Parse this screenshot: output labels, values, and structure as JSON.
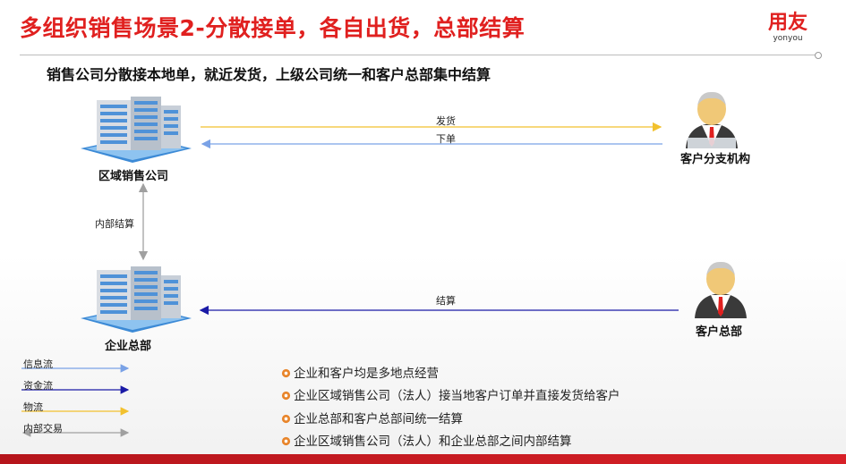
{
  "header": {
    "title": "多组织销售场景2-分散接单，各自出货，总部结算",
    "logo_main": "用友",
    "logo_sub": "yonyou"
  },
  "subtitle": "销售公司分散接本地单，就近发货，上级公司统一和客户总部集中结算",
  "nodes": {
    "regional_sales": "区域销售公司",
    "enterprise_hq": "企业总部",
    "customer_branch": "客户分支机构",
    "customer_hq": "客户总部"
  },
  "flows": {
    "ship": "发货",
    "order": "下单",
    "internal_settlement": "内部结算",
    "settlement": "结算"
  },
  "legend": {
    "info_flow": "信息流",
    "fund_flow": "资金流",
    "logistics": "物流",
    "internal_trade": "内部交易"
  },
  "bullets": [
    "企业和客户均是多地点经营",
    "企业区域销售公司（法人）接当地客户订单并直接发货给客户",
    "企业总部和客户总部间统一结算",
    "企业区域销售公司（法人）和企业总部之间内部结算"
  ],
  "colors": {
    "title_red": "#e0201f",
    "info_flow": "#7aa2e6",
    "fund_flow": "#1a1aa6",
    "logistics": "#f2c12e",
    "internal_trade": "#a0a0a0"
  }
}
